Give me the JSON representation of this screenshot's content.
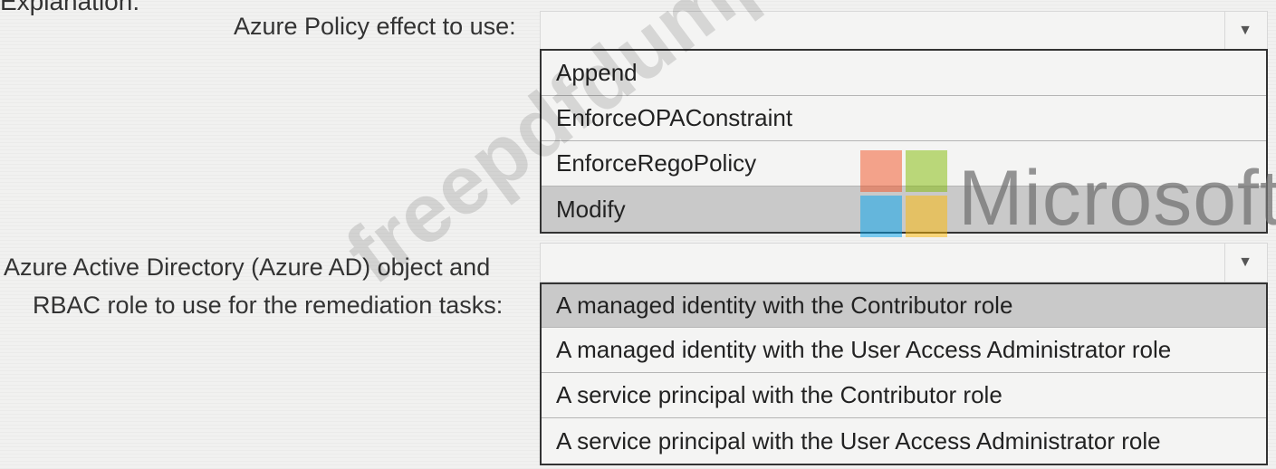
{
  "header": {
    "partial_text": "Explanation:"
  },
  "q1": {
    "label": "Azure Policy effect to use:",
    "options": [
      "Append",
      "EnforceOPAConstraint",
      "EnforceRegoPolicy",
      "Modify"
    ],
    "selected": "Modify"
  },
  "q2": {
    "label_line1": "Azure Active Directory (Azure AD) object and",
    "label_line2": "RBAC role to use for the remediation tasks:",
    "options": [
      "A managed identity with the Contributor role",
      "A managed identity with the User Access Administrator role",
      "A service principal with the Contributor role",
      "A service principal with the User Access Administrator role"
    ],
    "selected": "A managed identity with the Contributor role"
  },
  "logo": {
    "text": "Microsoft",
    "colors": [
      "#f25022",
      "#7fba00",
      "#00a4ef",
      "#ffb900"
    ]
  },
  "watermark": "freepdfdumps.com",
  "icons": {
    "dropdown": "chevron-down-icon"
  }
}
